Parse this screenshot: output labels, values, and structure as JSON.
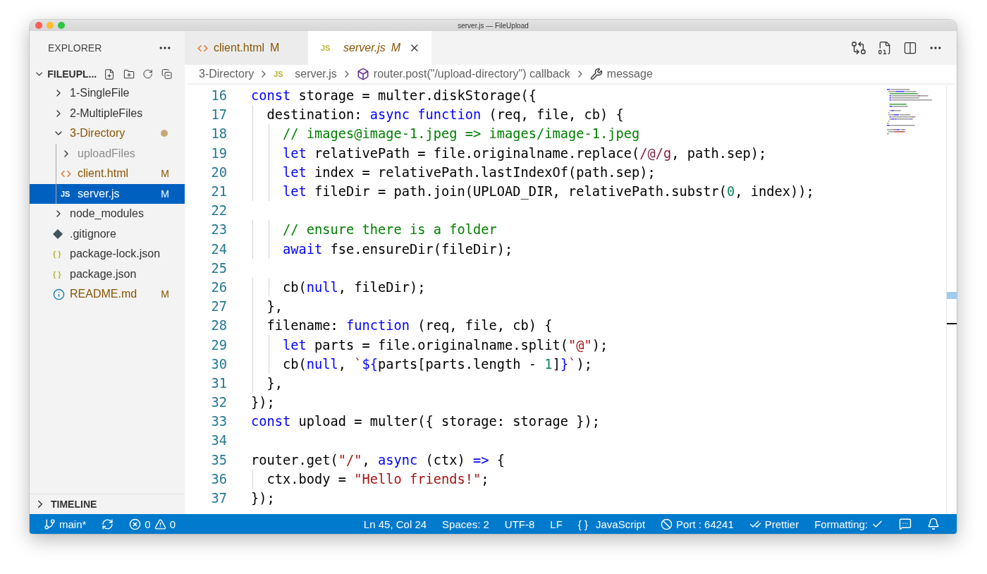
{
  "window": {
    "title": "server.js — FileUpload"
  },
  "sidebar": {
    "title": "EXPLORER",
    "project": {
      "name": "FILEUPL...",
      "expanded": true
    },
    "items": [
      {
        "name": "1-SingleFile",
        "kind": "folder",
        "expanded": false
      },
      {
        "name": "2-MultipleFiles",
        "kind": "folder",
        "expanded": false
      },
      {
        "name": "3-Directory",
        "kind": "folder",
        "expanded": true,
        "modified": true,
        "dot": true,
        "children": [
          {
            "name": "uploadFiles",
            "kind": "folder",
            "expanded": false,
            "ignored": true
          },
          {
            "name": "client.html",
            "kind": "html",
            "modified": true,
            "badge": "M",
            "selected": false
          },
          {
            "name": "server.js",
            "kind": "js",
            "icon_text": "JS",
            "modified": true,
            "badge": "M",
            "selected": true
          }
        ]
      },
      {
        "name": "node_modules",
        "kind": "folder",
        "expanded": false
      },
      {
        "name": ".gitignore",
        "kind": "git"
      },
      {
        "name": "package-lock.json",
        "kind": "json",
        "icon_text": "{ }"
      },
      {
        "name": "package.json",
        "kind": "json",
        "icon_text": "{ }"
      },
      {
        "name": "README.md",
        "kind": "info",
        "modified": true,
        "badge": "M"
      }
    ],
    "timeline": {
      "label": "TIMELINE",
      "expanded": false
    }
  },
  "tabs": [
    {
      "label": "client.html",
      "kind": "html",
      "badge": "M",
      "selected": false
    },
    {
      "label": "server.js",
      "kind": "js",
      "icon_text": "JS",
      "badge": "M",
      "selected": true
    }
  ],
  "breadcrumb": [
    {
      "label": "3-Directory",
      "kind": "folder"
    },
    {
      "label": "server.js",
      "kind": "js",
      "icon_text": "JS"
    },
    {
      "label": "router.post(\"/upload-directory\") callback",
      "kind": "method"
    },
    {
      "label": "message",
      "kind": "property"
    }
  ],
  "editor": {
    "lines": [
      {
        "number": "16",
        "tokens": [
          {
            "kind": "keyword",
            "text": "const"
          },
          {
            "kind": "plain",
            "text": " storage = multer.diskStorage({"
          }
        ]
      },
      {
        "number": "17",
        "tokens": [
          {
            "kind": "plain",
            "text": "  destination: "
          },
          {
            "kind": "keyword",
            "text": "async function"
          },
          {
            "kind": "plain",
            "text": " (req, file, cb) {"
          }
        ]
      },
      {
        "number": "18",
        "tokens": [
          {
            "kind": "comment",
            "text": "    // images@image-1.jpeg => images/image-1.jpeg"
          }
        ]
      },
      {
        "number": "19",
        "tokens": [
          {
            "kind": "keyword",
            "text": "    let"
          },
          {
            "kind": "plain",
            "text": " relativePath = file.originalname.replace("
          },
          {
            "kind": "regex",
            "text": "/@/g"
          },
          {
            "kind": "plain",
            "text": ", path.sep);"
          }
        ]
      },
      {
        "number": "20",
        "tokens": [
          {
            "kind": "keyword",
            "text": "    let"
          },
          {
            "kind": "plain",
            "text": " index = relativePath.lastIndexOf(path.sep);"
          }
        ]
      },
      {
        "number": "21",
        "tokens": [
          {
            "kind": "keyword",
            "text": "    let"
          },
          {
            "kind": "plain",
            "text": " fileDir = path.join(UPLOAD_DIR, relativePath.substr("
          },
          {
            "kind": "number",
            "text": "0"
          },
          {
            "kind": "plain",
            "text": ", index));"
          }
        ]
      },
      {
        "number": "22"
      },
      {
        "number": "23",
        "tokens": [
          {
            "kind": "comment",
            "text": "    // ensure there is a folder"
          }
        ]
      },
      {
        "number": "24",
        "tokens": [
          {
            "kind": "keyword",
            "text": "    await"
          },
          {
            "kind": "plain",
            "text": " fse.ensureDir(fileDir);"
          }
        ]
      },
      {
        "number": "25"
      },
      {
        "number": "26",
        "tokens": [
          {
            "kind": "plain",
            "text": "    cb("
          },
          {
            "kind": "keyword",
            "text": "null"
          },
          {
            "kind": "plain",
            "text": ", fileDir);"
          }
        ]
      },
      {
        "number": "27",
        "tokens": [
          {
            "kind": "plain",
            "text": "  },"
          }
        ]
      },
      {
        "number": "28",
        "tokens": [
          {
            "kind": "plain",
            "text": "  filename: "
          },
          {
            "kind": "keyword",
            "text": "function"
          },
          {
            "kind": "plain",
            "text": " (req, file, cb) {"
          }
        ]
      },
      {
        "number": "29",
        "tokens": [
          {
            "kind": "keyword",
            "text": "    let"
          },
          {
            "kind": "plain",
            "text": " parts = file.originalname.split("
          },
          {
            "kind": "string",
            "text": "\"@\""
          },
          {
            "kind": "plain",
            "text": ");"
          }
        ]
      },
      {
        "number": "30",
        "tokens": [
          {
            "kind": "plain",
            "text": "    cb("
          },
          {
            "kind": "keyword",
            "text": "null"
          },
          {
            "kind": "plain",
            "text": ", "
          },
          {
            "kind": "string",
            "text": "`"
          },
          {
            "kind": "keyword",
            "text": "${"
          },
          {
            "kind": "plain",
            "text": "parts[parts.length - "
          },
          {
            "kind": "number",
            "text": "1"
          },
          {
            "kind": "plain",
            "text": "]"
          },
          {
            "kind": "keyword",
            "text": "}"
          },
          {
            "kind": "string",
            "text": "`"
          },
          {
            "kind": "plain",
            "text": ");"
          }
        ]
      },
      {
        "number": "31",
        "tokens": [
          {
            "kind": "plain",
            "text": "  },"
          }
        ]
      },
      {
        "number": "32",
        "tokens": [
          {
            "kind": "plain",
            "text": "});"
          }
        ]
      },
      {
        "number": "33",
        "tokens": [
          {
            "kind": "keyword",
            "text": "const"
          },
          {
            "kind": "plain",
            "text": " upload = multer({ storage: storage });"
          }
        ]
      },
      {
        "number": "34"
      },
      {
        "number": "35",
        "tokens": [
          {
            "kind": "plain",
            "text": "router.get("
          },
          {
            "kind": "string",
            "text": "\"/\""
          },
          {
            "kind": "plain",
            "text": ", "
          },
          {
            "kind": "keyword",
            "text": "async"
          },
          {
            "kind": "plain",
            "text": " (ctx) "
          },
          {
            "kind": "keyword",
            "text": "=>"
          },
          {
            "kind": "plain",
            "text": " {"
          }
        ]
      },
      {
        "number": "36",
        "tokens": [
          {
            "kind": "plain",
            "text": "  ctx.body = "
          },
          {
            "kind": "string",
            "text": "\"Hello friends!\""
          },
          {
            "kind": "plain",
            "text": ";"
          }
        ]
      },
      {
        "number": "37",
        "tokens": [
          {
            "kind": "plain",
            "text": "});"
          }
        ]
      }
    ]
  },
  "status_bar": {
    "left": [
      {
        "kind": "branch",
        "label": "main*"
      },
      {
        "kind": "sync"
      },
      {
        "kind": "problems",
        "errors": "0",
        "warnings": "0"
      }
    ],
    "right": [
      {
        "kind": "text",
        "label": "Ln 45, Col 24"
      },
      {
        "kind": "text",
        "label": "Spaces: 2"
      },
      {
        "kind": "text",
        "label": "UTF-8"
      },
      {
        "kind": "text",
        "label": "LF"
      },
      {
        "kind": "language",
        "icon_text": "{ }",
        "label": "JavaScript"
      },
      {
        "kind": "port",
        "label": "Port : 64241"
      },
      {
        "kind": "prettier",
        "label": "Prettier"
      },
      {
        "kind": "formatting",
        "label": "Formatting:"
      },
      {
        "kind": "feedback"
      },
      {
        "kind": "bell"
      }
    ]
  }
}
